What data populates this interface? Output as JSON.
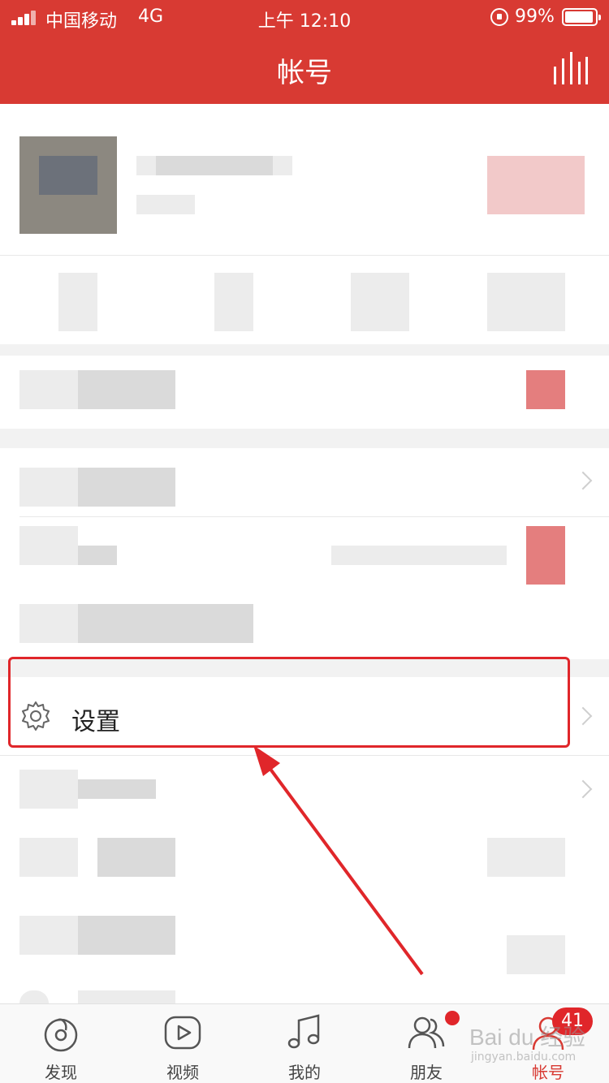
{
  "status_bar": {
    "carrier": "中国移动",
    "network": "4G",
    "time": "上午 12:10",
    "battery_percent": "99%"
  },
  "header": {
    "title": "帐号"
  },
  "settings_row": {
    "label": "设置"
  },
  "tabs": [
    {
      "label": "发现",
      "icon": "discover-icon"
    },
    {
      "label": "视频",
      "icon": "video-icon"
    },
    {
      "label": "我的",
      "icon": "music-note-icon"
    },
    {
      "label": "朋友",
      "icon": "friends-icon",
      "has_dot": true
    },
    {
      "label": "帐号",
      "icon": "account-icon",
      "active": true,
      "badge": "41"
    }
  ],
  "watermark": {
    "logo": "Bai du 经验",
    "url": "jingyan.baidu.com"
  },
  "colors": {
    "brand_red": "#d83a33",
    "annotation_red": "#e0262a"
  }
}
